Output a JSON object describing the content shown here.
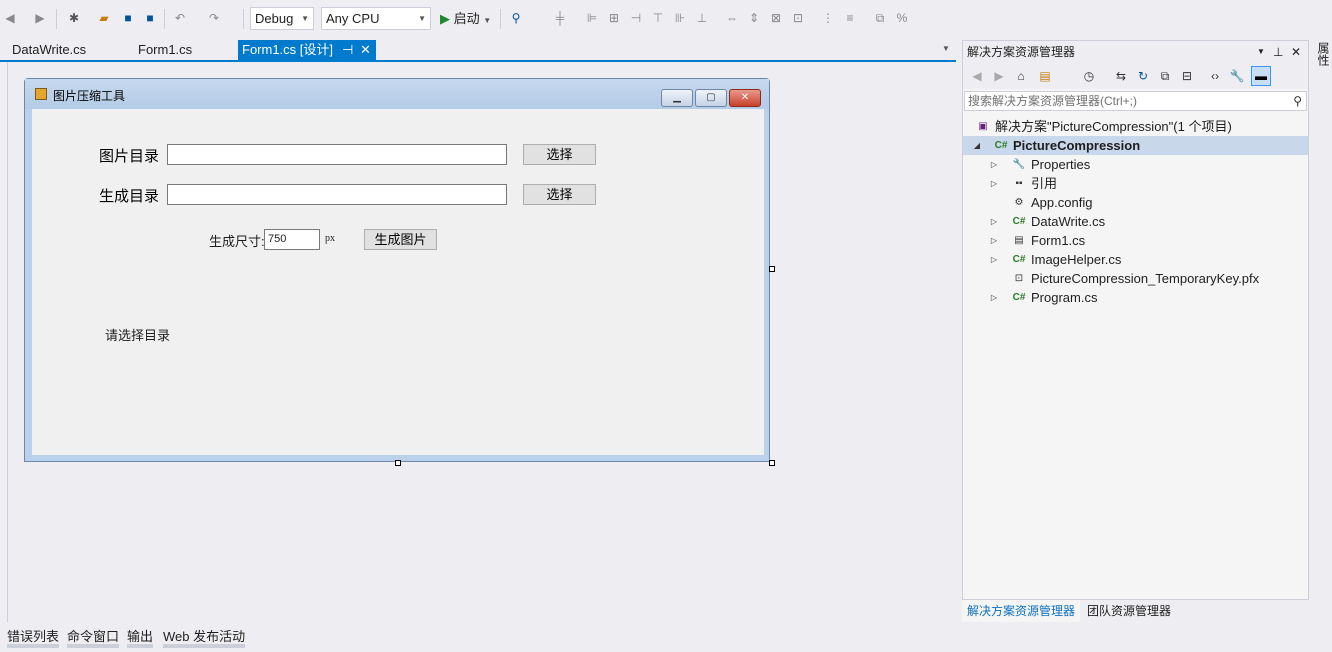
{
  "toolbar": {
    "config": "Debug",
    "platform": "Any CPU",
    "start_label": "启动"
  },
  "tabs": [
    {
      "label": "DataWrite.cs"
    },
    {
      "label": "Form1.cs"
    },
    {
      "label": "Form1.cs [设计]",
      "pin": "⊣",
      "close": "✕"
    }
  ],
  "form": {
    "title": "图片压缩工具",
    "image_dir_label": "图片目录",
    "image_dir_value": "",
    "out_dir_label": "生成目录",
    "out_dir_value": "",
    "choose1": "选择",
    "choose2": "选择",
    "size_label": "生成尺寸:",
    "size_value": "750",
    "size_unit": "px",
    "generate": "生成图片",
    "status": "请选择目录"
  },
  "solution_explorer": {
    "title": "解决方案资源管理器",
    "search_placeholder": "搜索解决方案资源管理器(Ctrl+;)",
    "tree": [
      {
        "label": "解决方案\"PictureCompression\"(1 个项目)",
        "icon": "solution-icon"
      },
      {
        "label": "PictureCompression",
        "icon": "csharp-project-icon"
      },
      {
        "label": "Properties",
        "icon": "wrench-icon"
      },
      {
        "label": "引用",
        "icon": "references-icon"
      },
      {
        "label": "App.config",
        "icon": "config-icon"
      },
      {
        "label": "DataWrite.cs",
        "icon": "csharp-file-icon"
      },
      {
        "label": "Form1.cs",
        "icon": "form-icon"
      },
      {
        "label": "ImageHelper.cs",
        "icon": "csharp-file-icon"
      },
      {
        "label": "PictureCompression_TemporaryKey.pfx",
        "icon": "certificate-icon"
      },
      {
        "label": "Program.cs",
        "icon": "csharp-file-icon"
      }
    ],
    "tabs": [
      "解决方案资源管理器",
      "团队资源管理器"
    ]
  },
  "bottom_tabs": [
    "错误列表",
    "命令窗口",
    "输出",
    "Web 发布活动"
  ],
  "right_strip": "属性",
  "colors": {
    "accent": "#007acc"
  }
}
